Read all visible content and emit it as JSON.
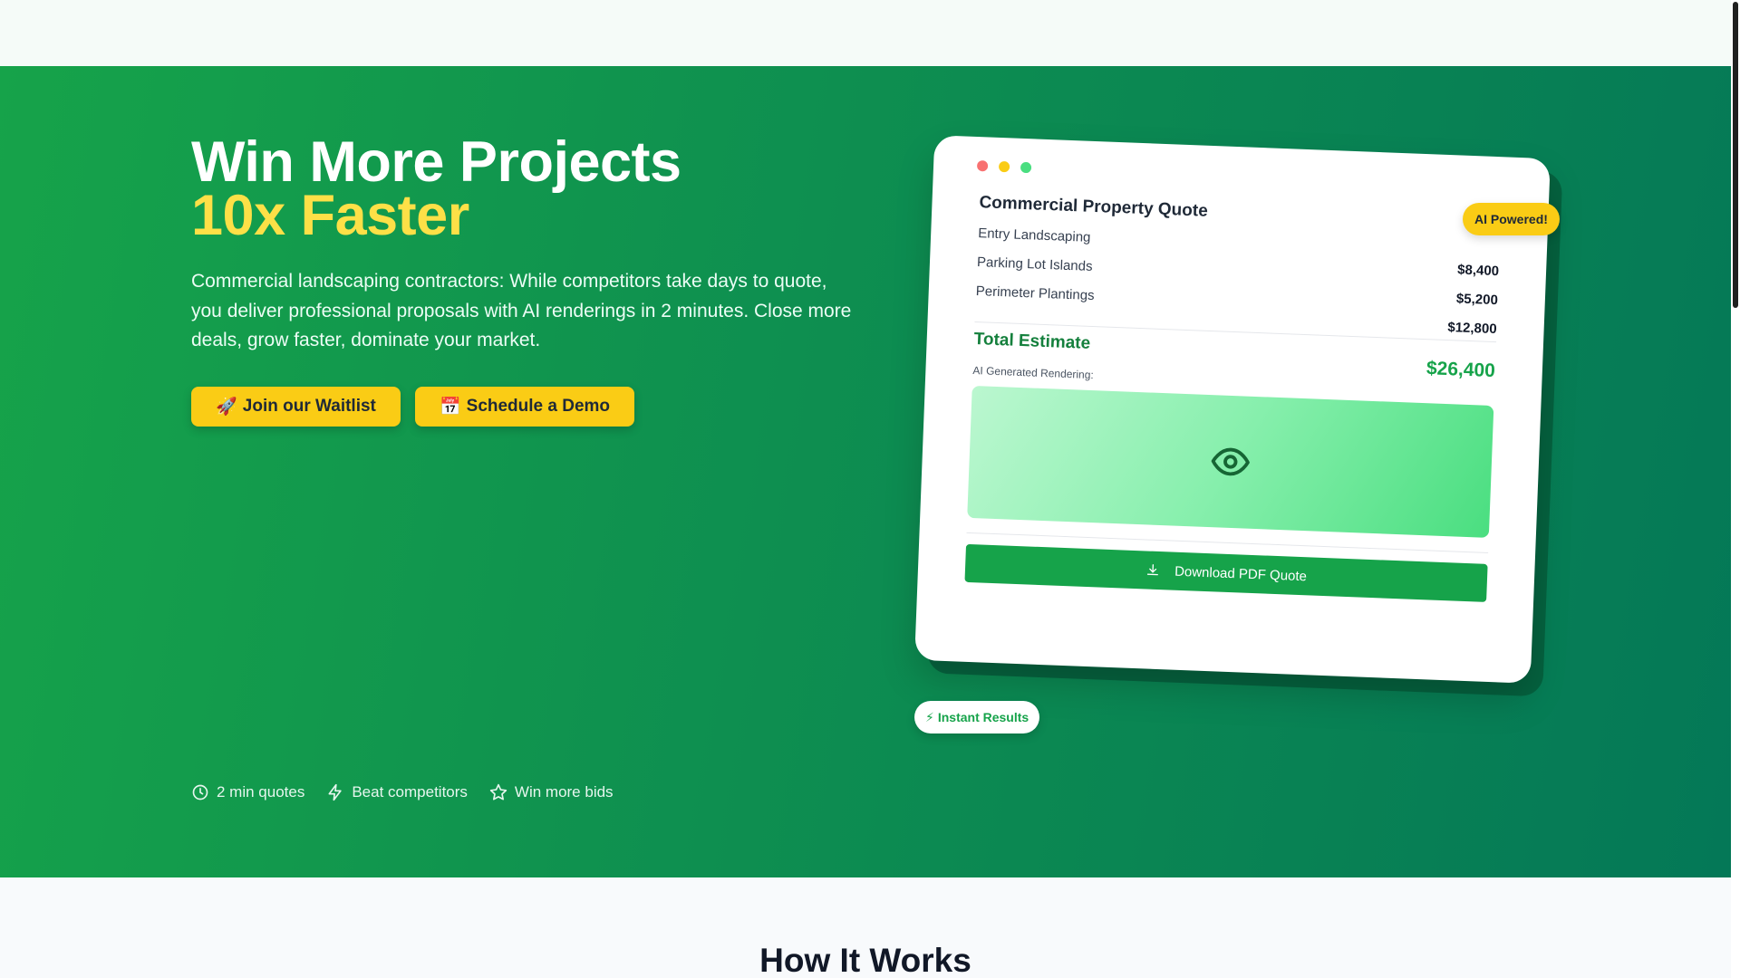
{
  "hero": {
    "title_line1": "Win More Projects",
    "title_line2": "10x Faster",
    "subtitle": "Commercial landscaping contractors: While competitors take days to quote, you deliver professional proposals with AI renderings in 2 minutes. Close more deals, grow faster, dominate your market.",
    "buttons": {
      "waitlist_icon": "🚀",
      "waitlist": "Join our Waitlist",
      "demo_icon": "📅",
      "demo": "Schedule a Demo"
    },
    "features": [
      {
        "icon": "clock-icon",
        "label": "2 min quotes"
      },
      {
        "icon": "lightning-icon",
        "label": "Beat competitors"
      },
      {
        "icon": "star-icon",
        "label": "Win more bids"
      }
    ]
  },
  "quote_card": {
    "badge_top": "AI Powered!",
    "badge_bottom_icon": "⚡",
    "badge_bottom": "Instant Results",
    "title": "Commercial Property Quote",
    "items": [
      {
        "label": "Entry Landscaping",
        "amount": "$8,400"
      },
      {
        "label": "Parking Lot Islands",
        "amount": "$5,200"
      },
      {
        "label": "Perimeter Plantings",
        "amount": "$12,800"
      }
    ],
    "total_label": "Total Estimate",
    "total_value": "$26,400",
    "render_label": "AI Generated Rendering:",
    "download_label": "Download PDF Quote"
  },
  "how_it_works": {
    "title": "How It Works"
  },
  "colors": {
    "hero_start": "#16a34a",
    "hero_end": "#047857",
    "accent_yellow": "#facc15",
    "title_yellow": "#fde047",
    "brand_green": "#16a34a"
  }
}
